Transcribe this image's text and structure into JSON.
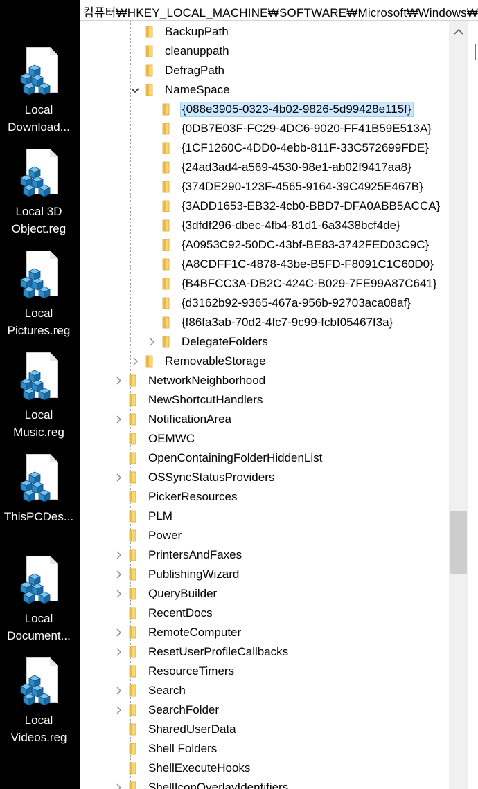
{
  "address_bar": {
    "path": "컴퓨터₩HKEY_LOCAL_MACHINE₩SOFTWARE₩Microsoft₩Windows₩C"
  },
  "desktop_icons": [
    {
      "name": "desktop-icon-local-downloads",
      "label": "Local Download...",
      "icon": "registry-file-icon"
    },
    {
      "name": "desktop-icon-local-3d-object",
      "label": "Local 3D Object.reg",
      "icon": "registry-file-icon"
    },
    {
      "name": "desktop-icon-local-pictures",
      "label": "Local Pictures.reg",
      "icon": "registry-file-icon"
    },
    {
      "name": "desktop-icon-local-music",
      "label": "Local Music.reg",
      "icon": "registry-file-icon"
    },
    {
      "name": "desktop-icon-thispcdes",
      "label": "ThisPCDes...",
      "icon": "registry-file-icon"
    },
    {
      "name": "desktop-icon-local-documents",
      "label": "Local Document...",
      "icon": "registry-file-icon"
    },
    {
      "name": "desktop-icon-local-videos",
      "label": "Local Videos.reg",
      "icon": "registry-file-icon"
    }
  ],
  "tree": [
    {
      "label": "BackupPath",
      "level": 1,
      "expander": "none",
      "selected": false
    },
    {
      "label": "cleanuppath",
      "level": 1,
      "expander": "none",
      "selected": false
    },
    {
      "label": "DefragPath",
      "level": 1,
      "expander": "none",
      "selected": false
    },
    {
      "label": "NameSpace",
      "level": 1,
      "expander": "expanded",
      "selected": false
    },
    {
      "label": "{088e3905-0323-4b02-9826-5d99428e115f}",
      "level": 2,
      "expander": "none",
      "selected": true
    },
    {
      "label": "{0DB7E03F-FC29-4DC6-9020-FF41B59E513A}",
      "level": 2,
      "expander": "none",
      "selected": false
    },
    {
      "label": "{1CF1260C-4DD0-4ebb-811F-33C572699FDE}",
      "level": 2,
      "expander": "none",
      "selected": false
    },
    {
      "label": "{24ad3ad4-a569-4530-98e1-ab02f9417aa8}",
      "level": 2,
      "expander": "none",
      "selected": false
    },
    {
      "label": "{374DE290-123F-4565-9164-39C4925E467B}",
      "level": 2,
      "expander": "none",
      "selected": false
    },
    {
      "label": "{3ADD1653-EB32-4cb0-BBD7-DFA0ABB5ACCA}",
      "level": 2,
      "expander": "none",
      "selected": false
    },
    {
      "label": "{3dfdf296-dbec-4fb4-81d1-6a3438bcf4de}",
      "level": 2,
      "expander": "none",
      "selected": false
    },
    {
      "label": "{A0953C92-50DC-43bf-BE83-3742FED03C9C}",
      "level": 2,
      "expander": "none",
      "selected": false
    },
    {
      "label": "{A8CDFF1C-4878-43be-B5FD-F8091C1C60D0}",
      "level": 2,
      "expander": "none",
      "selected": false
    },
    {
      "label": "{B4BFCC3A-DB2C-424C-B029-7FE99A87C641}",
      "level": 2,
      "expander": "none",
      "selected": false
    },
    {
      "label": "{d3162b92-9365-467a-956b-92703aca08af}",
      "level": 2,
      "expander": "none",
      "selected": false
    },
    {
      "label": "{f86fa3ab-70d2-4fc7-9c99-fcbf05467f3a}",
      "level": 2,
      "expander": "none",
      "selected": false
    },
    {
      "label": "DelegateFolders",
      "level": 2,
      "expander": "collapsed",
      "selected": false
    },
    {
      "label": "RemovableStorage",
      "level": 1,
      "expander": "collapsed",
      "selected": false
    },
    {
      "label": "NetworkNeighborhood",
      "level": 0,
      "expander": "collapsed",
      "selected": false
    },
    {
      "label": "NewShortcutHandlers",
      "level": 0,
      "expander": "none",
      "selected": false
    },
    {
      "label": "NotificationArea",
      "level": 0,
      "expander": "collapsed",
      "selected": false
    },
    {
      "label": "OEMWC",
      "level": 0,
      "expander": "none",
      "selected": false
    },
    {
      "label": "OpenContainingFolderHiddenList",
      "level": 0,
      "expander": "none",
      "selected": false
    },
    {
      "label": "OSSyncStatusProviders",
      "level": 0,
      "expander": "collapsed",
      "selected": false
    },
    {
      "label": "PickerResources",
      "level": 0,
      "expander": "none",
      "selected": false
    },
    {
      "label": "PLM",
      "level": 0,
      "expander": "none",
      "selected": false
    },
    {
      "label": "Power",
      "level": 0,
      "expander": "none",
      "selected": false
    },
    {
      "label": "PrintersAndFaxes",
      "level": 0,
      "expander": "collapsed",
      "selected": false
    },
    {
      "label": "PublishingWizard",
      "level": 0,
      "expander": "collapsed",
      "selected": false
    },
    {
      "label": "QueryBuilder",
      "level": 0,
      "expander": "collapsed",
      "selected": false
    },
    {
      "label": "RecentDocs",
      "level": 0,
      "expander": "none",
      "selected": false
    },
    {
      "label": "RemoteComputer",
      "level": 0,
      "expander": "collapsed",
      "selected": false
    },
    {
      "label": "ResetUserProfileCallbacks",
      "level": 0,
      "expander": "collapsed",
      "selected": false
    },
    {
      "label": "ResourceTimers",
      "level": 0,
      "expander": "none",
      "selected": false
    },
    {
      "label": "Search",
      "level": 0,
      "expander": "collapsed",
      "selected": false
    },
    {
      "label": "SearchFolder",
      "level": 0,
      "expander": "collapsed",
      "selected": false
    },
    {
      "label": "SharedUserData",
      "level": 0,
      "expander": "none",
      "selected": false
    },
    {
      "label": "Shell Folders",
      "level": 0,
      "expander": "none",
      "selected": false
    },
    {
      "label": "ShellExecuteHooks",
      "level": 0,
      "expander": "none",
      "selected": false
    },
    {
      "label": "ShellIconOverlayIdentifiers",
      "level": 0,
      "expander": "collapsed",
      "selected": false
    }
  ],
  "scrollbar": {
    "position_fraction": 0.64
  },
  "colors": {
    "selection_bg": "#cce8ff",
    "selection_border": "#99d1ff",
    "folder": "#f8d775",
    "folder_dark": "#e0b040",
    "registry_cube": "#2e8bc9"
  }
}
